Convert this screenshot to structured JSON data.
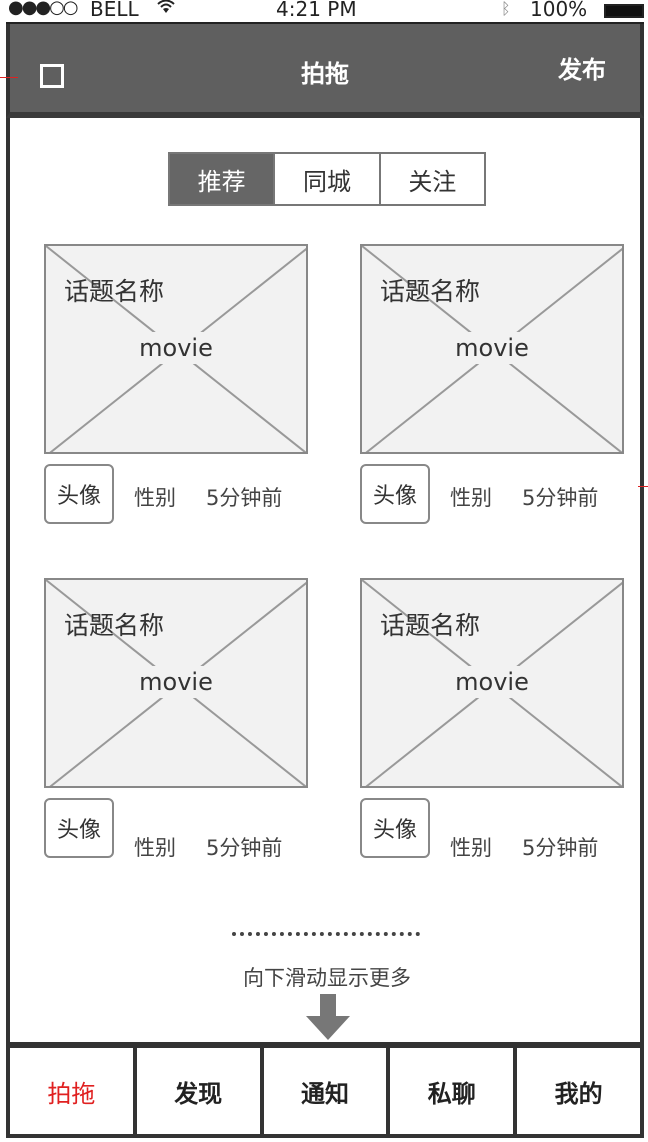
{
  "statusbar": {
    "signal": "●●●○○",
    "carrier": "BELL",
    "wifi": "wifi-icon",
    "time": "4:21 PM",
    "bluetooth": "bluetooth-icon",
    "battery": "100%"
  },
  "navbar": {
    "title": "拍拖",
    "publish_label": "发布",
    "left_icon": "square-icon"
  },
  "segments": [
    {
      "label": "推荐",
      "active": true
    },
    {
      "label": "同城",
      "active": false
    },
    {
      "label": "关注",
      "active": false
    }
  ],
  "cards": [
    {
      "topic": "话题名称",
      "media": "movie",
      "avatar": "头像",
      "gender": "性别",
      "time": "5分钟前"
    },
    {
      "topic": "话题名称",
      "media": "movie",
      "avatar": "头像",
      "gender": "性别",
      "time": "5分钟前"
    },
    {
      "topic": "话题名称",
      "media": "movie",
      "avatar": "头像",
      "gender": "性别",
      "time": "5分钟前"
    },
    {
      "topic": "话题名称",
      "media": "movie",
      "avatar": "头像",
      "gender": "性别",
      "time": "5分钟前"
    }
  ],
  "load_more": {
    "text": "向下滑动显示更多",
    "icon": "arrow-down-icon"
  },
  "tabbar": [
    {
      "label": "拍拖",
      "active": true
    },
    {
      "label": "发现",
      "active": false
    },
    {
      "label": "通知",
      "active": false
    },
    {
      "label": "私聊",
      "active": false
    },
    {
      "label": "我的",
      "active": false
    }
  ],
  "colors": {
    "navbar": "#5f5f5f",
    "active_segment": "#666666",
    "active_tab_text": "#e02020"
  }
}
